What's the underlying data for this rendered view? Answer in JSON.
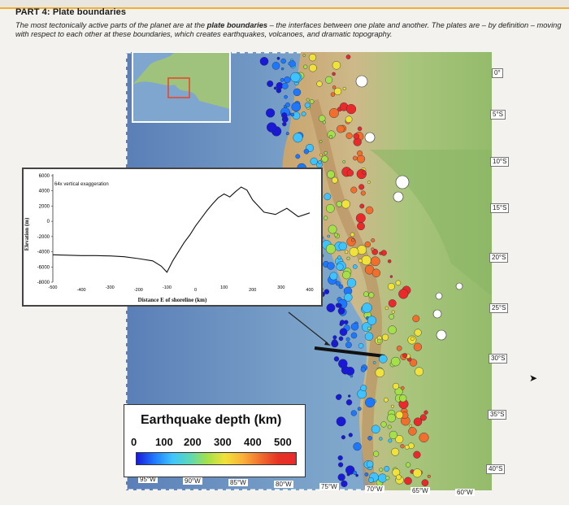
{
  "header": {
    "title": "PART 4: Plate boundaries",
    "intro_part1": "The most tectonically active parts of the planet are at the ",
    "intro_bold": "plate boundaries",
    "intro_part2": " – the interfaces between one plate and another. The plates are – by definition – moving with respect to each other at these boundaries, which creates earthquakes, volcanoes, and dramatic topography."
  },
  "map": {
    "latitude_labels": [
      "0°",
      "5°S",
      "10°S",
      "15°S",
      "20°S",
      "25°S",
      "30°S",
      "35°S",
      "40°S"
    ],
    "longitude_labels": [
      "95°W",
      "90°W",
      "85°W",
      "80°W",
      "75°W",
      "70°W",
      "65°W",
      "60°W"
    ]
  },
  "profile": {
    "annotation": "64x vertical exaggeration",
    "ylabel": "Elevation (m)",
    "xlabel": "Distance E of shoreline (km)",
    "y_ticks": [
      "6000",
      "4000",
      "2000",
      "0",
      "-2000",
      "-4000",
      "-6000",
      "-8000"
    ],
    "x_ticks": [
      "-500",
      "-400",
      "-300",
      "-200",
      "-100",
      "0",
      "100",
      "200",
      "300",
      "400"
    ]
  },
  "legend": {
    "title": "Earthquake depth (km)",
    "ticks": [
      "0",
      "100",
      "200",
      "300",
      "400",
      "500"
    ],
    "colors": [
      "#1a1ad6",
      "#1e78ff",
      "#3fc3ff",
      "#a5e04a",
      "#f0e23a",
      "#f06f2d",
      "#ea2a2a"
    ]
  },
  "chart_data": {
    "type": "line",
    "x": [
      -500,
      -450,
      -400,
      -350,
      -300,
      -250,
      -200,
      -150,
      -120,
      -100,
      -80,
      -60,
      -40,
      -20,
      0,
      20,
      40,
      60,
      80,
      100,
      120,
      140,
      160,
      180,
      200,
      240,
      280,
      320,
      360,
      400
    ],
    "y": [
      -4400,
      -4450,
      -4500,
      -4500,
      -4550,
      -4650,
      -4900,
      -5200,
      -5900,
      -6700,
      -5200,
      -4000,
      -2800,
      -1800,
      -600,
      400,
      1400,
      2300,
      3100,
      3600,
      3200,
      3900,
      4500,
      4100,
      2800,
      1200,
      900,
      1700,
      600,
      1100
    ],
    "xlabel": "Distance E of shoreline (km)",
    "ylabel": "Elevation (m)",
    "xlim": [
      -500,
      400
    ],
    "ylim": [
      -8000,
      6000
    ]
  }
}
